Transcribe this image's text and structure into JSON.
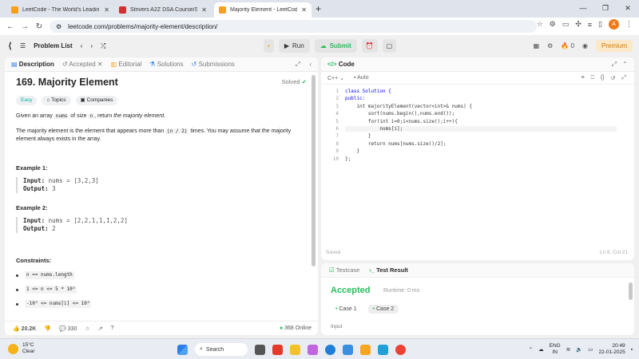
{
  "browser": {
    "tabs": [
      {
        "title": "LeetCode - The World's Leadin",
        "color": "#f89f1b"
      },
      {
        "title": "Strivers A2Z DSA Course/Shee",
        "color": "#d03030"
      },
      {
        "title": "Majority Element - LeetCode",
        "color": "#f89f1b"
      }
    ],
    "url": "leetcode.com/problems/majority-element/description/",
    "profile_initial": "A"
  },
  "lc": {
    "problem_list": "Problem List",
    "run": "Run",
    "submit": "Submit",
    "streak": "0",
    "premium": "Premium"
  },
  "left_tabs": [
    "Description",
    "Accepted",
    "Editorial",
    "Solutions",
    "Submissions"
  ],
  "problem": {
    "title": "169. Majority Element",
    "solved": "Solved",
    "difficulty": "Easy",
    "topics": "Topics",
    "companies": "Companies",
    "p1_a": "Given an array",
    "p1_code1": "nums",
    "p1_b": "of size",
    "p1_code2": "n",
    "p1_c": ", return",
    "p1_em": "the majority element",
    "p1_d": ".",
    "p2_a": "The majority element is the element that appears more than",
    "p2_code": "⌊n / 2⌋",
    "p2_b": "times. You may assume that the majority element always exists in the array.",
    "ex1_title": "Example 1:",
    "ex1_input_label": "Input:",
    "ex1_input": "nums = [3,2,3]",
    "ex1_output_label": "Output:",
    "ex1_output": "3",
    "ex2_title": "Example 2:",
    "ex2_input_label": "Input:",
    "ex2_input": "nums = [2,2,1,1,1,2,2]",
    "ex2_output_label": "Output:",
    "ex2_output": "2",
    "constraints_title": "Constraints:",
    "constraints": [
      "n == nums.length",
      "1 <= n <= 5 * 10⁴",
      "-10⁹ <= nums[i] <= 10⁹"
    ],
    "likes": "20.2K",
    "comments": "330",
    "online": "368 Online"
  },
  "code": {
    "title": "Code",
    "lang": "C++",
    "auto": "Auto",
    "lines": [
      "class Solution {",
      "public:",
      "    int majorityElement(vector<int>& nums) {",
      "        sort(nums.begin(),nums.end());",
      "        for(int i=0;i<nums.size();i++){",
      "            nums[i];",
      "        }",
      "        return nums[nums.size()/2];",
      "    }",
      "};"
    ],
    "saved": "Saved",
    "cursor": "Ln 6, Col 21"
  },
  "result": {
    "testcase_tab": "Testcase",
    "result_tab": "Test Result",
    "status": "Accepted",
    "runtime": "Runtime: 0 ms",
    "cases": [
      "Case 1",
      "Case 2"
    ],
    "input_label": "Input"
  },
  "taskbar": {
    "temp": "15°C",
    "weather": "Clear",
    "search": "Search",
    "lang1": "ENG",
    "lang2": "IN",
    "time": "20:49",
    "date": "22-01-2025"
  }
}
